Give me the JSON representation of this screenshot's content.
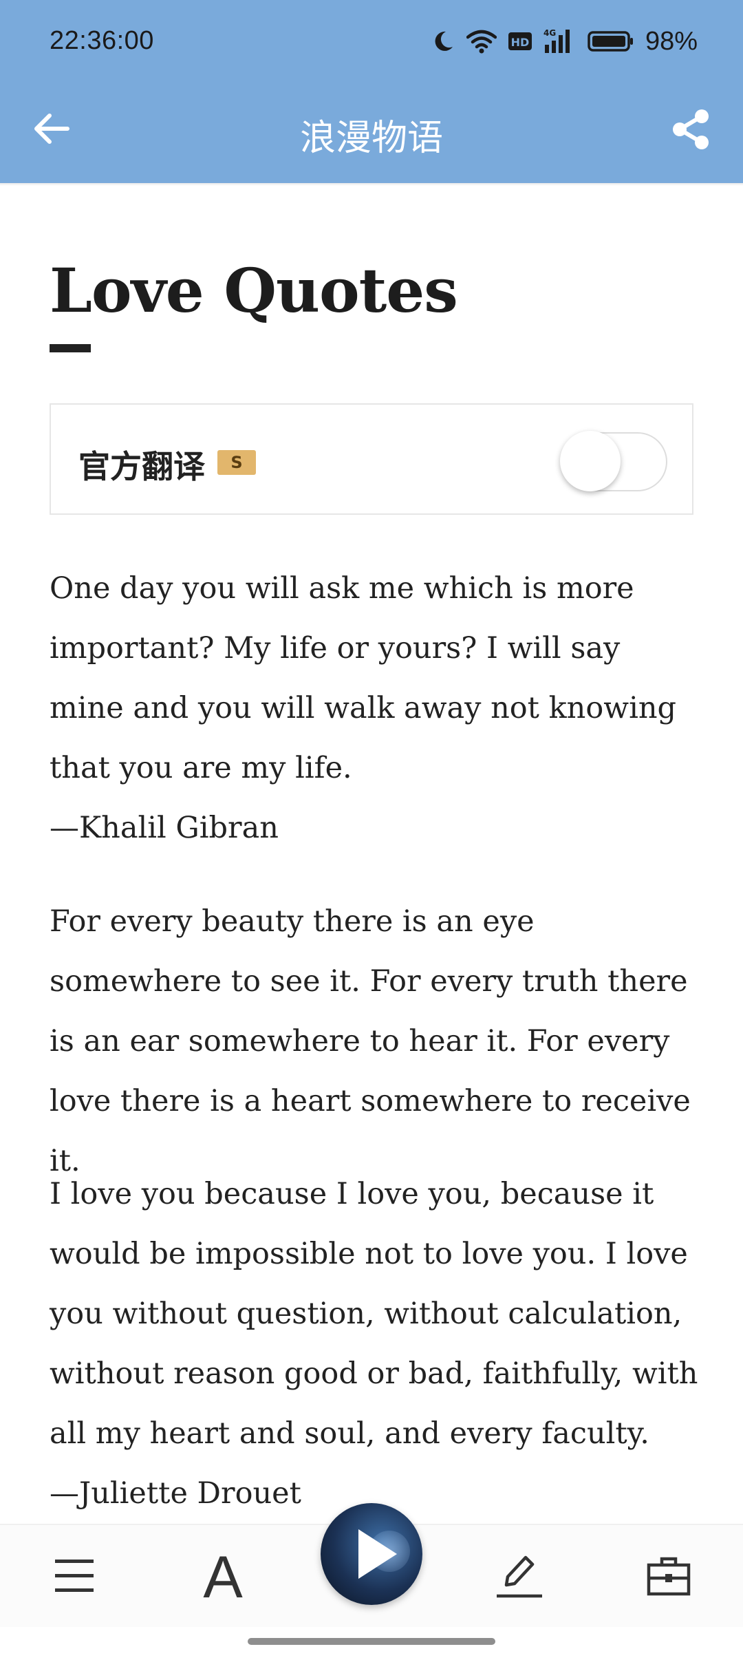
{
  "status_bar": {
    "time": "22:36:00",
    "battery": "98%",
    "icons": [
      "moon-icon",
      "wifi-icon",
      "hd-icon",
      "4g-signal-icon",
      "battery-icon"
    ]
  },
  "header": {
    "title": "浪漫物语",
    "back_icon": "back-arrow-icon",
    "share_icon": "share-icon",
    "background_color": "#7aaadb"
  },
  "article": {
    "title": "Love Quotes",
    "translation": {
      "label": "官方翻译",
      "badge": "S",
      "enabled": false
    },
    "quotes": [
      {
        "text": "One day you will ask me which is more important? My life or yours? I will say mine and you will walk away not knowing that you are my life.",
        "author": "—Khalil Gibran"
      },
      {
        "text": "For every beauty there is an eye somewhere to see it. For every truth there is an ear somewhere to hear it. For every love there is a heart somewhere to receive it.",
        "author": ""
      },
      {
        "text": "I love you because I love you, because it would be impossible not to love you. I love you without question, without calculation, without reason good or bad, faithfully, with all my heart and soul, and every faculty.",
        "author": "—Juliette Drouet"
      }
    ]
  },
  "toolbar": {
    "items": [
      "menu-icon",
      "font-icon",
      "play-button",
      "edit-icon",
      "toolkit-icon"
    ],
    "font_glyph": "A"
  }
}
